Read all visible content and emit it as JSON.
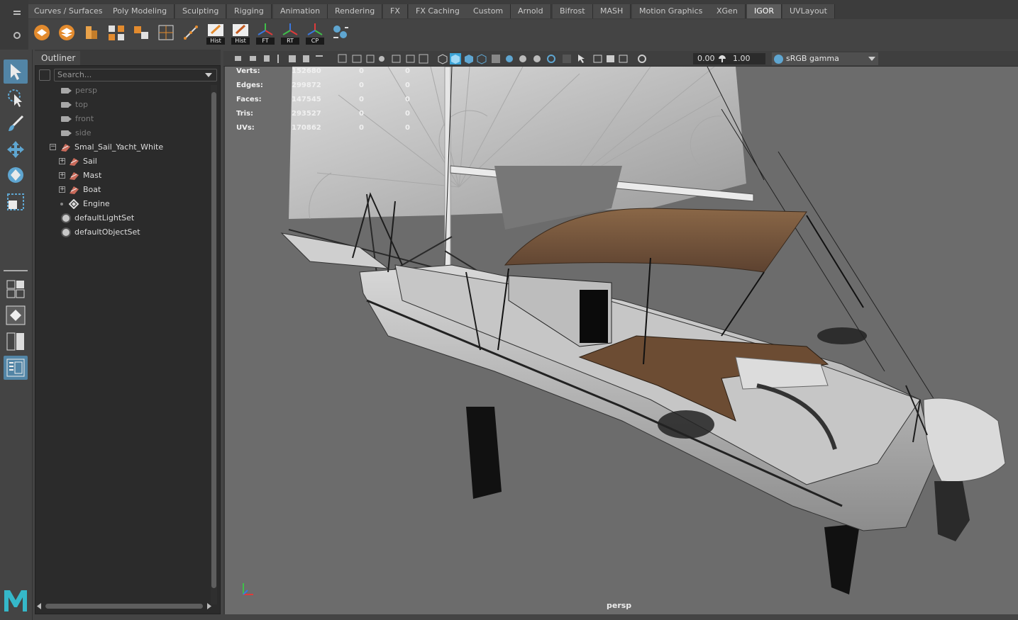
{
  "shelf": {
    "tabs": [
      "Curves / Surfaces",
      "Poly Modeling",
      "Sculpting",
      "Rigging",
      "Animation",
      "Rendering",
      "FX",
      "FX Caching",
      "Custom",
      "Arnold",
      "Bifrost",
      "MASH",
      "Motion Graphics",
      "XGen",
      "IGOR",
      "UVLayout"
    ],
    "active_tab": "IGOR",
    "icon_badges": [
      "Hist",
      "Hist",
      "FT",
      "RT",
      "CP"
    ]
  },
  "outliner": {
    "tab_label": "Outliner",
    "search_placeholder": "Search...",
    "cameras": [
      "persp",
      "top",
      "front",
      "side"
    ],
    "group_label": "Smal_Sail_Yacht_White",
    "children": [
      "Sail",
      "Mast",
      "Boat",
      "Engine"
    ],
    "sets": [
      "defaultLightSet",
      "defaultObjectSet"
    ]
  },
  "viewport": {
    "exposure": "0.00",
    "gamma": "1.00",
    "color_space": "sRGB gamma",
    "camera_label": "persp",
    "hud": [
      {
        "label": "Verts:",
        "total": "152680",
        "selected": "0",
        "component": "0"
      },
      {
        "label": "Edges:",
        "total": "299872",
        "selected": "0",
        "component": "0"
      },
      {
        "label": "Faces:",
        "total": "147545",
        "selected": "0",
        "component": "0"
      },
      {
        "label": "Tris:",
        "total": "293527",
        "selected": "0",
        "component": "0"
      },
      {
        "label": "UVs:",
        "total": "170862",
        "selected": "0",
        "component": "0"
      }
    ]
  },
  "colors": {
    "accent": "#5285a6",
    "viewport_bg": "#6c6c6c",
    "panel_bg": "#444444",
    "awning": "#7a5a3f"
  }
}
